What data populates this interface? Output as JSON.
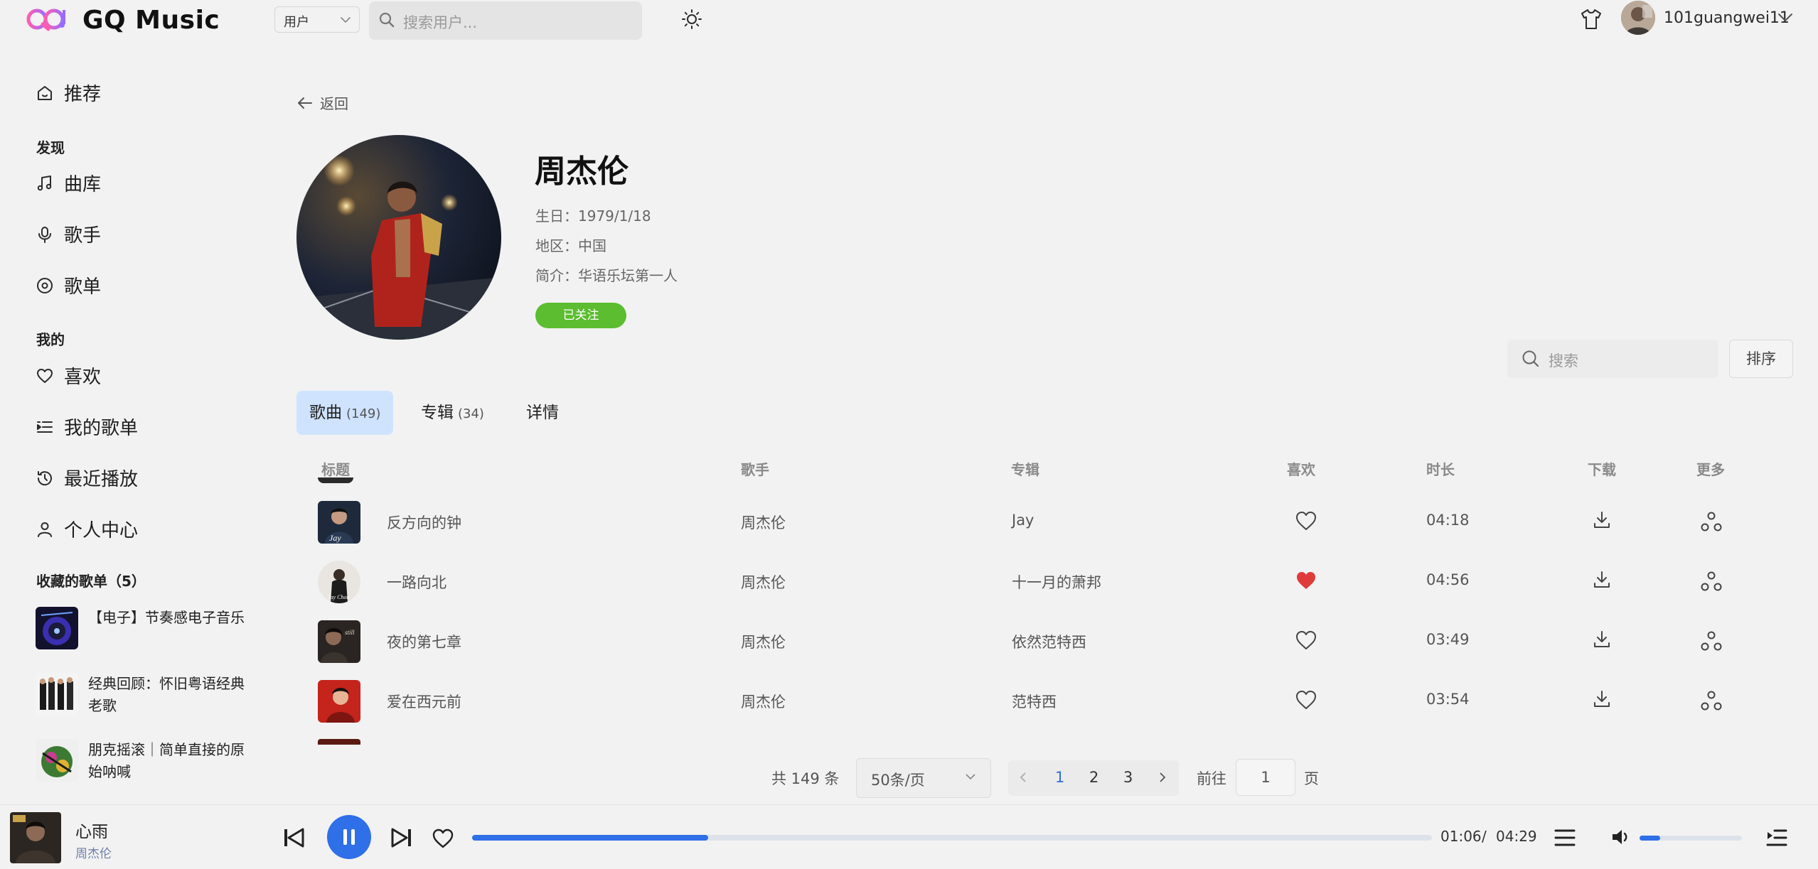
{
  "app": {
    "title": "GQ Music"
  },
  "header": {
    "search_type": "用户",
    "search_placeholder": "搜索用户...",
    "username": "101guangwei11"
  },
  "sidebar": {
    "recommend": "推荐",
    "discover_title": "发现",
    "discover": [
      "曲库",
      "歌手",
      "歌单"
    ],
    "mine_title": "我的",
    "mine": [
      "喜欢",
      "我的歌单",
      "最近播放",
      "个人中心"
    ],
    "collected_title": "收藏的歌单（5）",
    "playlists": [
      "【电子】节奏感电子音乐",
      "经典回顾：怀旧粤语经典老歌",
      "朋克摇滚｜简单直接的原始呐喊"
    ]
  },
  "artist": {
    "back": "返回",
    "name": "周杰伦",
    "birthday": "生日：1979/1/18",
    "region": "地区：中国",
    "intro": "简介：华语乐坛第一人",
    "follow": "已关注"
  },
  "list_search_placeholder": "搜索",
  "sort_label": "排序",
  "tabs": [
    {
      "label": "歌曲",
      "count": "(149)"
    },
    {
      "label": "专辑",
      "count": "(34)"
    },
    {
      "label": "详情",
      "count": ""
    }
  ],
  "table": {
    "headers": [
      "标题",
      "歌手",
      "专辑",
      "喜欢",
      "时长",
      "下载",
      "更多"
    ],
    "rows": [
      {
        "title": "反方向的钟",
        "artist": "周杰伦",
        "album": "Jay",
        "liked": false,
        "duration": "04:18"
      },
      {
        "title": "一路向北",
        "artist": "周杰伦",
        "album": "十一月的萧邦",
        "liked": true,
        "duration": "04:56"
      },
      {
        "title": "夜的第七章",
        "artist": "周杰伦",
        "album": "依然范特西",
        "liked": false,
        "duration": "03:49"
      },
      {
        "title": "爱在西元前",
        "artist": "周杰伦",
        "album": "范特西",
        "liked": false,
        "duration": "03:54"
      }
    ]
  },
  "pagination": {
    "total": "共 149 条",
    "page_size": "50条/页",
    "pages": [
      "1",
      "2",
      "3"
    ],
    "current": "1",
    "goto": "前往",
    "goto_value": "1",
    "page_suffix": "页"
  },
  "player": {
    "title": "心雨",
    "artist": "周杰伦",
    "current_time": "01:06",
    "separator": "/",
    "total_time": "04:29",
    "progress": 0.246,
    "volume": 0.2
  },
  "colors": {
    "accent": "#2f6fe8",
    "like": "#e03b3b",
    "follow": "#5bbd2f",
    "tab_active": "#cfe3ff"
  },
  "icons": [
    "logo-icon",
    "chevron-down-icon",
    "search-icon",
    "sun-icon",
    "shirt-icon",
    "home-icon",
    "music-note-icon",
    "microphone-icon",
    "disc-icon",
    "heart-icon",
    "list-icon",
    "history-icon",
    "user-icon",
    "arrow-left-icon",
    "download-icon",
    "share-icon",
    "prev-icon",
    "pause-icon",
    "next-icon",
    "playlist-icon",
    "volume-icon",
    "queue-icon"
  ]
}
